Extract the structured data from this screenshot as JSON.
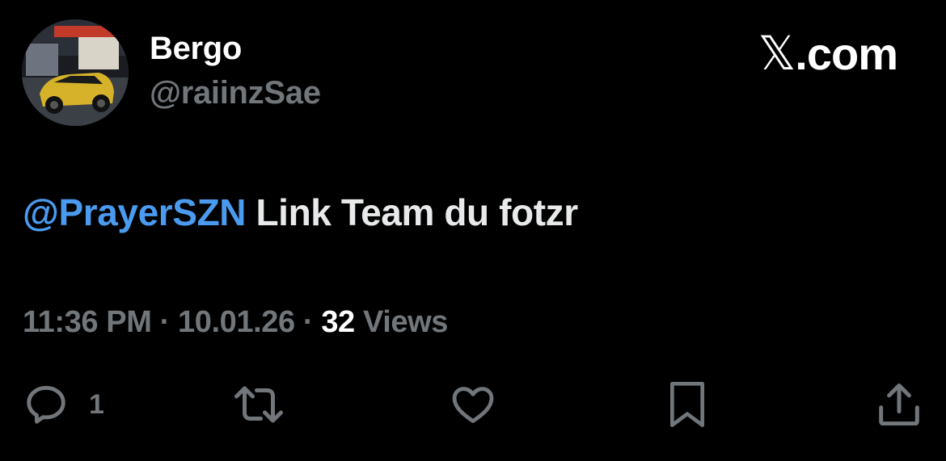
{
  "author": {
    "display_name": "Bergo",
    "handle": "@raiinzSae",
    "avatar_icon": "avatar-car-photo"
  },
  "brand": {
    "label": ".com",
    "glyph": "𝕏"
  },
  "tweet": {
    "mention": "@PrayerSZN",
    "text": "Link Team du fotzr"
  },
  "meta": {
    "time": "11:36 PM",
    "sep1": " · ",
    "date": "10.01.26",
    "sep2": " · ",
    "views_count": "32",
    "views_label": " Views"
  },
  "actions": {
    "reply_count": "1",
    "icons": [
      "reply-icon",
      "retweet-icon",
      "like-icon",
      "bookmark-icon",
      "share-icon"
    ]
  },
  "colors": {
    "background": "#000000",
    "text": "#e7e9ea",
    "secondary": "#71767b",
    "mention": "#4a9bf0"
  }
}
